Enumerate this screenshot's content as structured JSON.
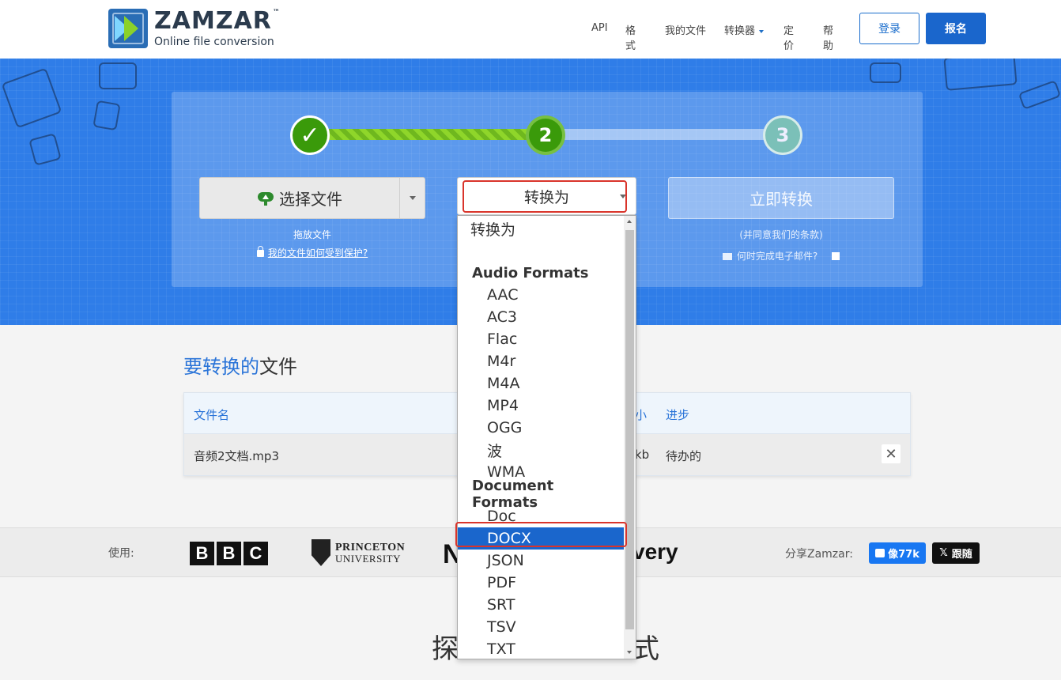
{
  "brand": {
    "name": "ZAMZAR",
    "tm": "™",
    "tagline": "Online file conversion"
  },
  "nav": {
    "api": "API",
    "formats": "格式",
    "my_files": "我的文件",
    "converters": "转换器",
    "pricing": "定价",
    "help": "帮助",
    "login": "登录",
    "signup": "报名"
  },
  "steps": {
    "step1": "✓",
    "step2": "2",
    "step3": "3"
  },
  "choose": {
    "label": "选择文件",
    "drag": "拖放文件",
    "protect": "我的文件如何受到保护?"
  },
  "convert_to": {
    "label": "转换为"
  },
  "convert_now": {
    "label": "立即转换",
    "terms": "(并同意我们的条款)",
    "email": "何时完成电子邮件?"
  },
  "files_section": {
    "title_blue": "要转换的",
    "title_rest": "文件"
  },
  "table": {
    "headers": {
      "name": "文件名",
      "size": "小",
      "progress": "进步"
    },
    "row": {
      "name": "音频2文档.mp3",
      "size": "kb",
      "progress": "待办的",
      "remove": "✕"
    }
  },
  "logos": {
    "used_by": "使用:",
    "bbc": [
      "B",
      "B",
      "C"
    ],
    "princeton_a": "PRINCETON",
    "princeton_b": "UNIVERSITY",
    "partial_left": "N",
    "partial_right": "very",
    "share": "分享Zamzar:",
    "fb_like": "像77k",
    "x_follow": "跟随",
    "x_icon": "𝕏"
  },
  "bottom": {
    "title_left": "探",
    "title_right": "式"
  },
  "dropdown": {
    "first": "转换为",
    "audio_group": "Audio Formats",
    "audio": [
      "AAC",
      "AC3",
      "Flac",
      "M4r",
      "M4A",
      "MP4",
      "OGG",
      "波",
      "WMA"
    ],
    "document_group": "Document Formats",
    "document": [
      "Doc",
      "DOCX",
      "JSON",
      "PDF",
      "SRT",
      "TSV",
      "TXT"
    ],
    "selected": "DOCX"
  },
  "colors": {
    "hero": "#2f7de8",
    "accent": "#1a66cc",
    "green": "#3a9a0a",
    "highlight": "#d9342b"
  }
}
